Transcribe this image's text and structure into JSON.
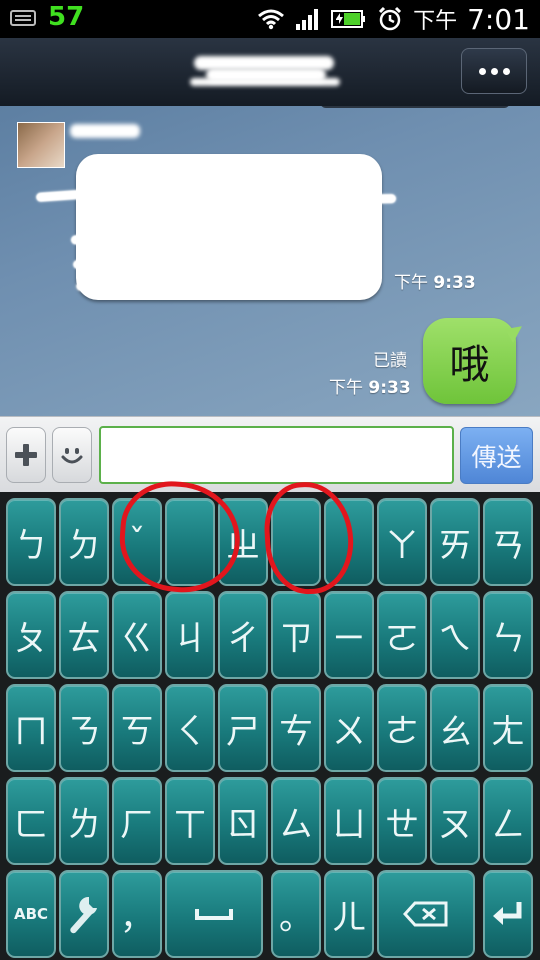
{
  "status_bar": {
    "notification_count": "57",
    "time_prefix": "下午",
    "time": "7:01"
  },
  "header": {
    "menu_label": "more"
  },
  "messages": {
    "incoming_time_prefix": "下午",
    "incoming_time": "9:33",
    "outgoing_text": "哦",
    "outgoing_read": "已讀",
    "outgoing_time_prefix": "下午",
    "outgoing_time": "9:33"
  },
  "input": {
    "value": "",
    "placeholder": "",
    "send_label": "傳送"
  },
  "keyboard": {
    "row1": [
      "ㄅ",
      "ㄉ",
      "ˇ",
      "",
      "ㄓ",
      "",
      "˙",
      "ㄚ",
      "ㄞ",
      "ㄢ"
    ],
    "row2": [
      "ㄆ",
      "ㄊ",
      "ㄍ",
      "ㄐ",
      "ㄔ",
      "ㄗ",
      "ㄧ",
      "ㄛ",
      "ㄟ",
      "ㄣ"
    ],
    "row3": [
      "ㄇ",
      "ㄋ",
      "ㄎ",
      "ㄑ",
      "ㄕ",
      "ㄘ",
      "ㄨ",
      "ㄜ",
      "ㄠ",
      "ㄤ"
    ],
    "row4": [
      "ㄈ",
      "ㄌ",
      "ㄏ",
      "ㄒ",
      "ㄖ",
      "ㄙ",
      "ㄩ",
      "ㄝ",
      "ㄡ",
      "ㄥ"
    ],
    "bottom": {
      "abc": "ABC",
      "comma": "，",
      "period": "。",
      "er": "ㄦ"
    }
  },
  "icons": [
    "keyboard-icon",
    "wifi-icon",
    "signal-icon",
    "battery-icon",
    "alarm-icon",
    "plus-icon",
    "smiley-icon",
    "wrench-icon",
    "space-icon",
    "backspace-icon",
    "enter-icon"
  ],
  "colors": {
    "accent_send": "#5b90de",
    "key_teal": "#1b8082",
    "annotation_red": "#e2161d",
    "bubble_green": "#86d44e"
  }
}
